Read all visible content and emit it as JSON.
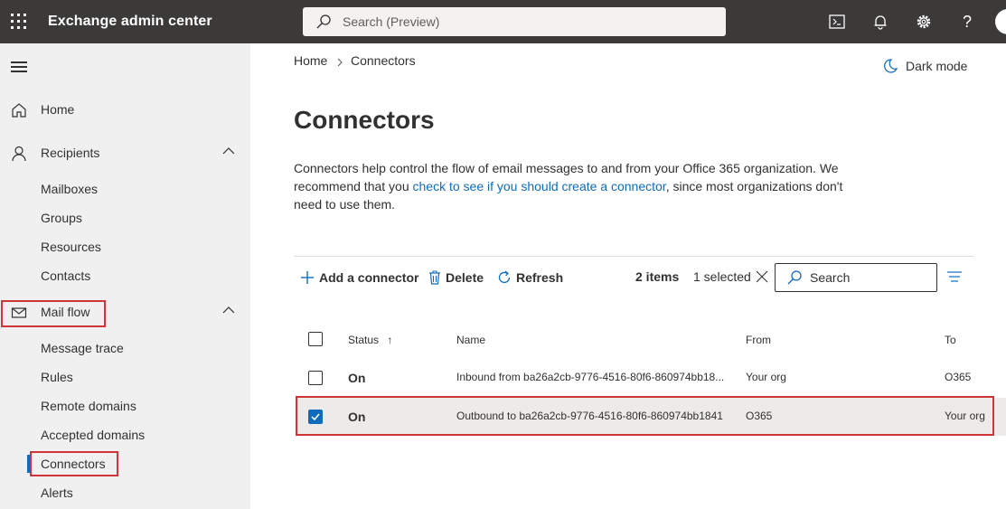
{
  "header": {
    "app_title": "Exchange admin center",
    "search_placeholder": "Search (Preview)"
  },
  "nav": {
    "home": "Home",
    "recipients": "Recipients",
    "recipients_sub": [
      "Mailboxes",
      "Groups",
      "Resources",
      "Contacts"
    ],
    "mail_flow": "Mail flow",
    "mail_flow_sub": [
      "Message trace",
      "Rules",
      "Remote domains",
      "Accepted domains",
      "Connectors",
      "Alerts"
    ]
  },
  "breadcrumb": {
    "home": "Home",
    "current": "Connectors"
  },
  "dark_mode_label": "Dark mode",
  "page": {
    "title": "Connectors",
    "desc_before": "Connectors help control the flow of email messages to and from your Office 365 organization. We recommend that you ",
    "desc_link": "check to see if you should create a connector",
    "desc_after": ", since most organizations don't need to use them."
  },
  "commands": {
    "add": "Add a connector",
    "delete": "Delete",
    "refresh": "Refresh",
    "items_count": "2 items",
    "selected": "1 selected",
    "search_placeholder": "Search"
  },
  "table": {
    "headers": {
      "status": "Status",
      "name": "Name",
      "from": "From",
      "to": "To"
    },
    "rows": [
      {
        "status": "On",
        "name": "Inbound from ba26a2cb-9776-4516-80f6-860974bb18...",
        "from": "Your org",
        "to": "O365",
        "checked": false
      },
      {
        "status": "On",
        "name": "Outbound to ba26a2cb-9776-4516-80f6-860974bb1841",
        "from": "O365",
        "to": "Your org",
        "checked": true
      }
    ]
  },
  "colors": {
    "accent": "#0f6cbd",
    "topbar": "#3b3a39",
    "highlight": "#d13438",
    "nav_bg": "#f0f0f0"
  }
}
